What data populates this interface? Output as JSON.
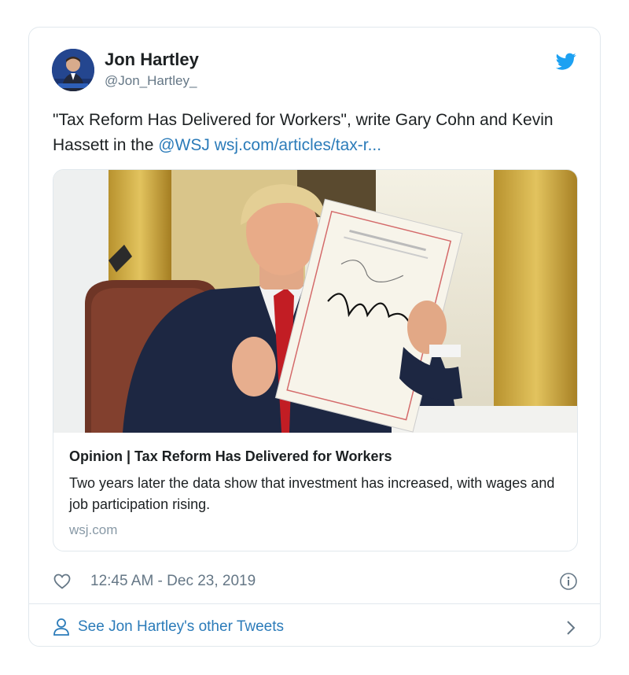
{
  "author": {
    "name": "Jon Hartley",
    "handle": "@Jon_Hartley_"
  },
  "tweet": {
    "text_before": "\"Tax Reform Has Delivered for Workers\", write Gary Cohn and Kevin Hassett in the ",
    "mention": "@WSJ",
    "url": "wsj.com/articles/tax-r..."
  },
  "link_card": {
    "title": "Opinion | Tax Reform Has Delivered for Workers",
    "description": "Two years later the data show that investment has increased, with wages and job participation rising.",
    "domain": "wsj.com"
  },
  "footer": {
    "timestamp": "12:45 AM - Dec 23, 2019",
    "more_tweets": "See Jon Hartley's other Tweets"
  },
  "colors": {
    "link": "#2b7bb9",
    "twitter_blue": "#1da1f2",
    "muted": "#657786",
    "border": "#e1e8ed"
  },
  "icons": [
    "twitter-bird-icon",
    "heart-icon",
    "info-icon",
    "user-icon",
    "chevron-right-icon"
  ]
}
